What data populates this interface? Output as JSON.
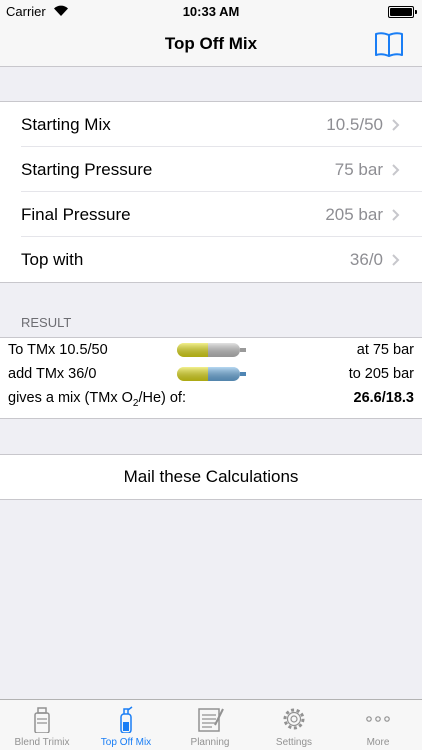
{
  "status_bar": {
    "carrier": "Carrier",
    "time": "10:33 AM"
  },
  "nav": {
    "title": "Top Off Mix",
    "icon": "book-icon"
  },
  "settings": [
    {
      "label": "Starting Mix",
      "value": "10.5/50"
    },
    {
      "label": "Starting Pressure",
      "value": "75 bar"
    },
    {
      "label": "Final Pressure",
      "value": "205 bar"
    },
    {
      "label": "Top with",
      "value": "36/0"
    }
  ],
  "result": {
    "header": "RESULT",
    "rows": [
      {
        "left": "To TMx 10.5/50",
        "right": "at 75 bar"
      },
      {
        "left": "add TMx 36/0",
        "right": "to 205 bar"
      },
      {
        "left_prefix": "gives a mix (TMx O",
        "left_sub": "2",
        "left_suffix": "/He) of:",
        "right": "26.6/18.3"
      }
    ]
  },
  "mail_button": "Mail these Calculations",
  "tabs": [
    {
      "label": "Blend Trimix"
    },
    {
      "label": "Top Off Mix"
    },
    {
      "label": "Planning"
    },
    {
      "label": "Settings"
    },
    {
      "label": "More"
    }
  ],
  "colors": {
    "accent": "#1a7ef5",
    "tank_yellow": "#e6e21a",
    "tank_gray": "#c8c8c8",
    "tank_blue": "#6fb2e6"
  }
}
